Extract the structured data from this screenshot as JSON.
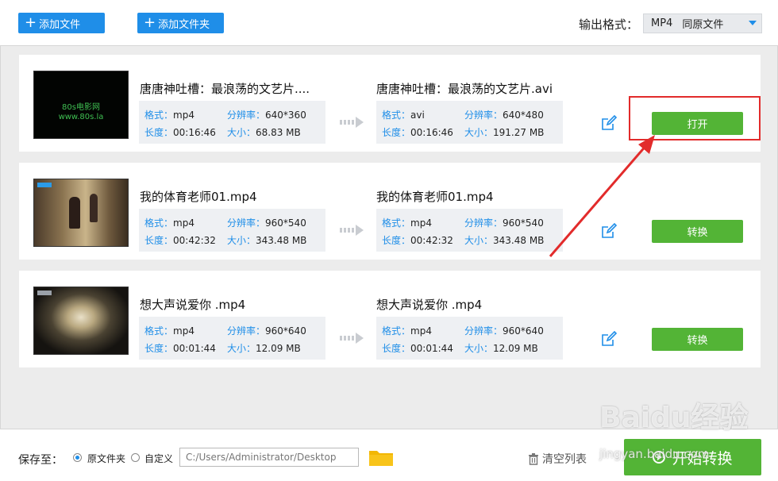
{
  "toolbar": {
    "add_file_label": "添加文件",
    "add_folder_label": "添加文件夹",
    "format_label": "输出格式：",
    "format_value": "MP4",
    "format_sub": "同原文件"
  },
  "files": [
    {
      "thumb_text_1": "80s电影网",
      "thumb_text_2": "www.80s.la",
      "src_name": "唐唐神吐槽：最浪荡的文艺片....",
      "src_format_key": "格式：",
      "src_format": "mp4",
      "src_res_key": "分辨率：",
      "src_res": "640*360",
      "src_len_key": "长度：",
      "src_len": "00:16:46",
      "src_size_key": "大小：",
      "src_size": "68.83 MB",
      "dst_name": "唐唐神吐槽：最浪荡的文艺片.avi",
      "dst_format_key": "格式：",
      "dst_format": "avi",
      "dst_res_key": "分辨率：",
      "dst_res": "640*480",
      "dst_len_key": "长度：",
      "dst_len": "00:16:46",
      "dst_size_key": "大小：",
      "dst_size": "191.27 MB",
      "action_label": "打开"
    },
    {
      "src_name": "我的体育老师01.mp4",
      "src_format_key": "格式：",
      "src_format": "mp4",
      "src_res_key": "分辨率：",
      "src_res": "960*540",
      "src_len_key": "长度：",
      "src_len": "00:42:32",
      "src_size_key": "大小：",
      "src_size": "343.48 MB",
      "dst_name": "我的体育老师01.mp4",
      "dst_format_key": "格式：",
      "dst_format": "mp4",
      "dst_res_key": "分辨率：",
      "dst_res": "960*540",
      "dst_len_key": "长度：",
      "dst_len": "00:42:32",
      "dst_size_key": "大小：",
      "dst_size": "343.48 MB",
      "action_label": "转换"
    },
    {
      "src_name": "想大声说爱你 .mp4",
      "src_format_key": "格式：",
      "src_format": "mp4",
      "src_res_key": "分辨率：",
      "src_res": "960*640",
      "src_len_key": "长度：",
      "src_len": "00:01:44",
      "src_size_key": "大小：",
      "src_size": "12.09 MB",
      "dst_name": "想大声说爱你 .mp4",
      "dst_format_key": "格式：",
      "dst_format": "mp4",
      "dst_res_key": "分辨率：",
      "dst_res": "960*640",
      "dst_len_key": "长度：",
      "dst_len": "00:01:44",
      "dst_size_key": "大小：",
      "dst_size": "12.09 MB",
      "action_label": "转换"
    }
  ],
  "bottom": {
    "save_label": "保存至：",
    "opt_original": "原文件夹",
    "opt_custom": "自定义",
    "path_value": "C:/Users/Administrator/Desktop",
    "clear_label": "清空列表",
    "start_label": "开始转换"
  },
  "watermark": {
    "logo": "Baidu经验",
    "url": "jingyan.baidu.com"
  },
  "colors": {
    "accent_blue": "#1f8ee8",
    "action_green": "#53b436",
    "annotation_red": "#e22b2b"
  }
}
